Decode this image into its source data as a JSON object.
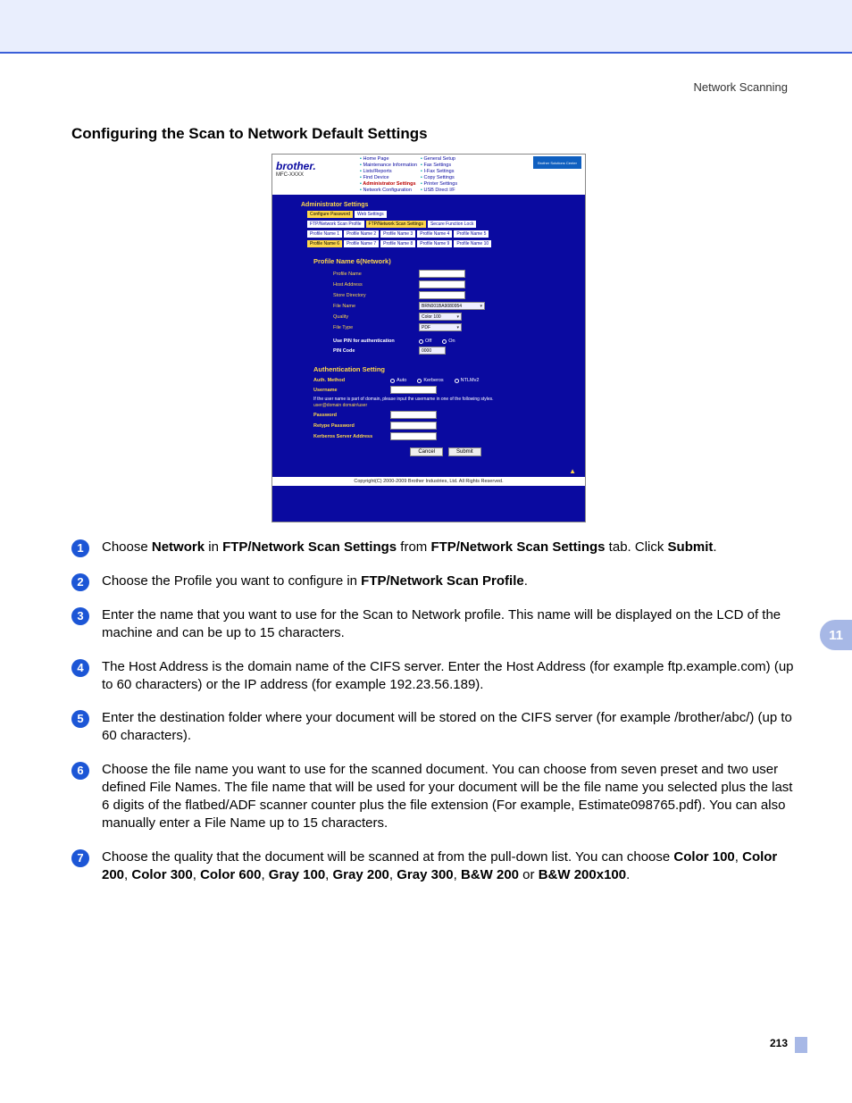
{
  "header_right": "Network Scanning",
  "section_title": "Configuring the Scan to Network Default Settings",
  "chapter_number": "11",
  "page_number": "213",
  "config": {
    "brand": "brother.",
    "model": "MFC-XXXX",
    "nav_left": [
      "Home Page",
      "Maintenance Information",
      "Lists/Reports",
      "Find Device",
      "Administrator Settings",
      "Network Configuration"
    ],
    "nav_right": [
      "General Setup",
      "Fax Settings",
      "I-Fax Settings",
      "Copy Settings",
      "Printer Settings",
      "USB Direct I/F"
    ],
    "solutions_center": "Brother Solutions Center",
    "admin_settings": "Administrator Settings",
    "tabrow1": [
      "Configure Password",
      "Web Settings"
    ],
    "tabrow2": [
      "FTP/Network Scan Profile",
      "FTP/Network Scan Settings",
      "Secure Function Lock"
    ],
    "tabrow3": [
      "Profile Name 1",
      "Profile Name 2",
      "Profile Name 3",
      "Profile Name 4",
      "Profile Name 5"
    ],
    "tabrow4": [
      "Profile Name 6",
      "Profile Name 7",
      "Profile Name 8",
      "Profile Name 9",
      "Profile Name 10"
    ],
    "profile_header": "Profile Name 6(Network)",
    "fields": {
      "profile_name": "Profile Name",
      "host_address": "Host Address",
      "store_directory": "Store Directory",
      "file_name": "File Name",
      "file_name_val": "BRN001BA9080954",
      "quality": "Quality",
      "quality_val": "Color 100",
      "file_type": "File Type",
      "file_type_val": "PDF",
      "use_pin": "Use PIN for authentication",
      "pin_off": "Off",
      "pin_on": "On",
      "pin_code": "PIN Code",
      "pin_code_val": "0000"
    },
    "auth_header": "Authentication Setting",
    "auth": {
      "method": "Auth. Method",
      "auto": "Auto",
      "kerberos": "Kerberos",
      "ntlmv2": "NTLMv2",
      "username": "Username",
      "note_main": "If the user name is part of domain, please input the username in one of the following styles.",
      "note_sub": "user@domain\ndomain\\user",
      "password": "Password",
      "retype_password": "Retype Password",
      "kerberos_server": "Kerberos Server Address"
    },
    "buttons": {
      "cancel": "Cancel",
      "submit": "Submit"
    },
    "back_top": "▲",
    "copyright": "Copyright(C) 2000-2009 Brother Industries, Ltd. All Rights Reserved."
  },
  "steps": {
    "s1": {
      "pre": "Choose ",
      "b1": "Network",
      "mid1": " in ",
      "b2": "FTP/Network Scan Settings",
      "mid2": " from ",
      "b3": "FTP/Network Scan Settings",
      "mid3": " tab. Click ",
      "b4": "Submit",
      "post": "."
    },
    "s2": {
      "pre": "Choose the Profile you want to configure in ",
      "b1": "FTP/Network Scan Profile",
      "post": "."
    },
    "s3": "Enter the name that you want to use for the Scan to Network profile. This name will be displayed on the LCD of the machine and can be up to 15 characters.",
    "s4": "The Host Address is the domain name of the CIFS server. Enter the Host Address (for example ftp.example.com) (up to 60 characters) or the IP address (for example 192.23.56.189).",
    "s5": "Enter the destination folder where your document will be stored on the CIFS server (for example /brother/abc/) (up to 60 characters).",
    "s6": "Choose the file name you want to use for the scanned document. You can choose from seven preset and two user defined File Names. The file name that will be used for your document will be the file name you selected plus the last 6 digits of the flatbed/ADF scanner counter plus the file extension (For example, Estimate098765.pdf). You can also manually enter a File Name up to 15 characters.",
    "s7": {
      "pre": "Choose the quality that the document will be scanned at from the pull-down list. You can choose ",
      "opts": [
        "Color 100",
        "Color 200",
        "Color 300",
        "Color 600",
        "Gray 100",
        "Gray 200",
        "Gray 300",
        "B&W 200"
      ],
      "or": " or ",
      "last": "B&W 200x100",
      "post": "."
    }
  }
}
